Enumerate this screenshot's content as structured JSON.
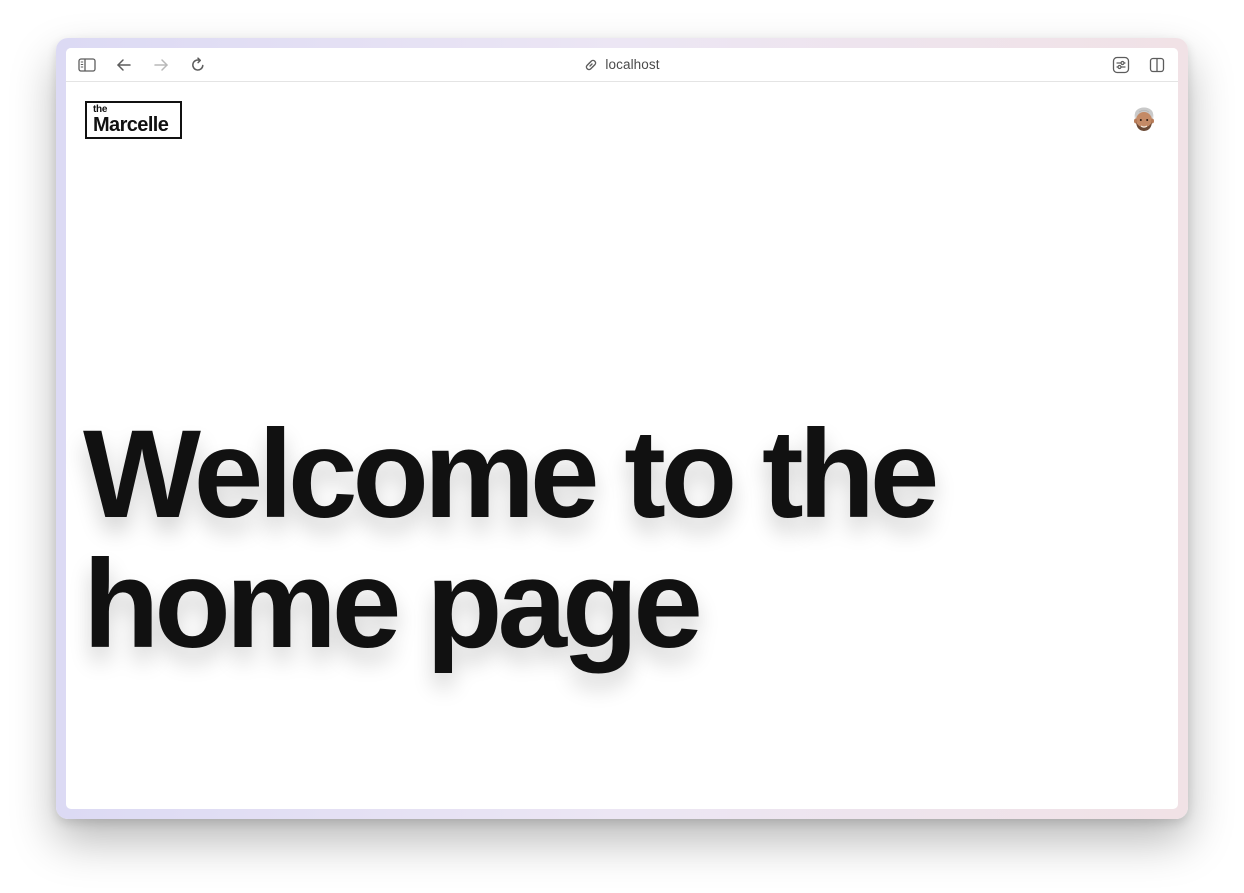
{
  "browser": {
    "address_bar": {
      "url_text": "localhost"
    },
    "icons": {
      "sidebar": "sidebar-icon",
      "back": "back-arrow-icon",
      "forward": "forward-arrow-icon",
      "reload": "reload-icon",
      "link": "link-icon",
      "extensions": "extensions-icon",
      "split_view": "split-view-icon"
    }
  },
  "site": {
    "logo": {
      "small": "the",
      "name": "Marcelle"
    },
    "hero": {
      "line1": "Welcome to the",
      "line2": "home page"
    }
  },
  "colors": {
    "text": "#111111",
    "frame_left": "#dcdaf4",
    "frame_right": "#f1e2e6",
    "toolbar_icon": "#5c5c5c",
    "toolbar_icon_disabled": "#b8b8b8"
  }
}
